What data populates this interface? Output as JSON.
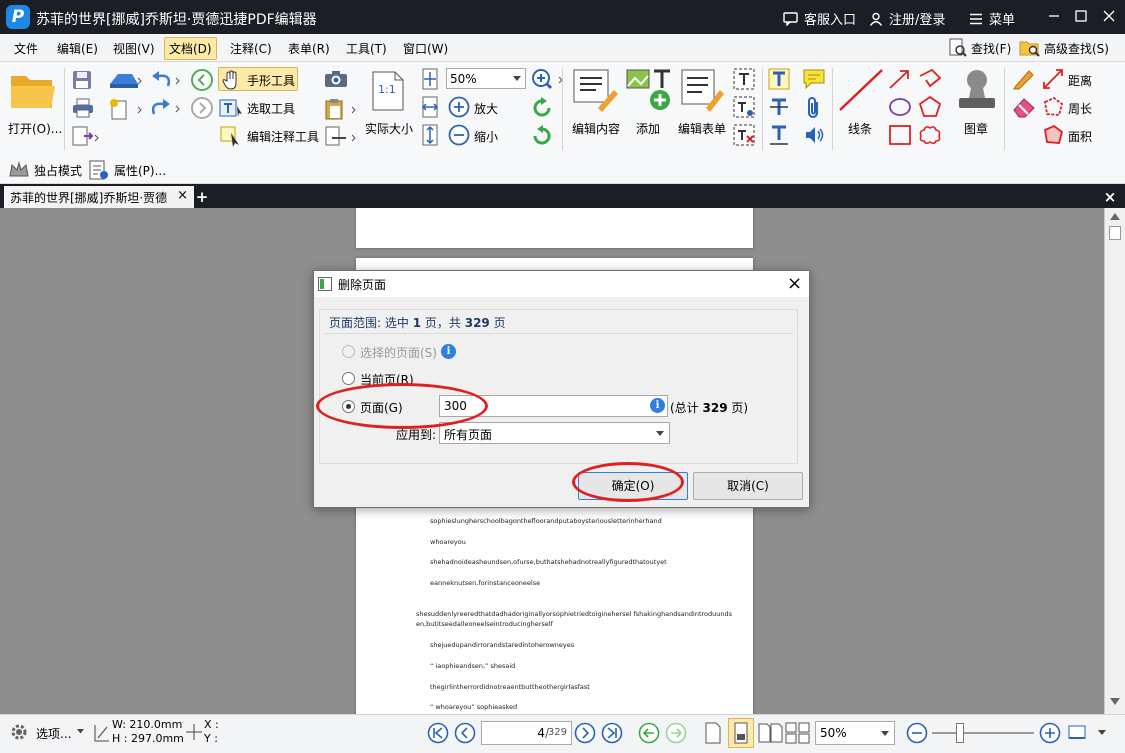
{
  "app": {
    "title": "苏菲的世界[挪威]乔斯坦·贾德迅捷PDF编辑器",
    "logo_letter": "P",
    "support": "客服入口",
    "login": "注册/登录",
    "menu": "菜单"
  },
  "menubar": {
    "items": [
      "文件",
      "编辑(E)",
      "视图(V)",
      "文档(D)",
      "注释(C)",
      "表单(R)",
      "工具(T)",
      "窗口(W)"
    ],
    "active": "文档(D)",
    "find": "查找(F)",
    "advanced_find": "高级查找(S)"
  },
  "toolbar": {
    "open": "打开(O)...",
    "hand_tool": "手形工具",
    "select_tool": "选取工具",
    "edit_annotation_tool": "编辑注释工具",
    "actual_size": "实际大小",
    "actual_size_glyph": "1:1",
    "zoom_value": "50%",
    "zoom_in": "放大",
    "zoom_out": "缩小",
    "edit_content": "编辑内容",
    "add": "添加",
    "edit_form": "编辑表单",
    "line": "线条",
    "stamp": "图章",
    "distance": "距离",
    "perimeter": "周长",
    "area": "面积",
    "exclusive_mode": "独占模式",
    "properties": "属性(P)..."
  },
  "tab": {
    "title": "苏菲的世界[挪威]乔斯坦·贾德",
    "close": "×",
    "add": "+",
    "close_all": "×"
  },
  "page_text": [
    "sophieslungherschoolbagonthefloorandputaboysteriousletterinherhand",
    "whoareyou",
    "shehadnoideasheundsen,ofurse,buthatshehadnotreallyfiguredthatoutyet",
    "eanneknutsen,forinstanceoneelse",
    "shesuddenlyreeredthatdadhadoriginallyorsophietriedtoiginehersel fshakinghandsandintroduunds",
    "en,butitseedalleoneelseintroducingherself",
    "shejuedupandirrorandstaredintoherowneyes",
    "“ iaophieandsen,” shesaid",
    "thegirlintherrordidnotreaentbuttheothergirlasfast",
    "“ whoareyou” sophieasked"
  ],
  "dialog": {
    "title": "删除页面",
    "close": "×",
    "range_prefix": "页面范围: 选中",
    "range_selected": "1",
    "range_mid": "页，共",
    "range_total": "329",
    "range_suffix": "页",
    "option_selected_pages": "选择的页面(S)",
    "option_current_page": "当前页(R)",
    "option_pages": "页面(G)",
    "pages_value": "300",
    "total_prefix": "(总计",
    "total_value": "329",
    "total_suffix": "页)",
    "apply_to_label": "应用到:",
    "apply_to_value": "所有页面",
    "ok": "确定(O)",
    "cancel": "取消(C)",
    "info_glyph": "i"
  },
  "status": {
    "options": "选项...",
    "width": "W: 210.0mm",
    "height": "H : 297.0mm",
    "x": "X :",
    "y": "Y :",
    "page_current": "4",
    "page_total": "329",
    "zoom": "50%"
  },
  "colors": {
    "titlebar": "#1b1e24",
    "accent_blue": "#1e88e5",
    "highlight_red": "#e02020",
    "doc_background": "#8e8e8e"
  }
}
